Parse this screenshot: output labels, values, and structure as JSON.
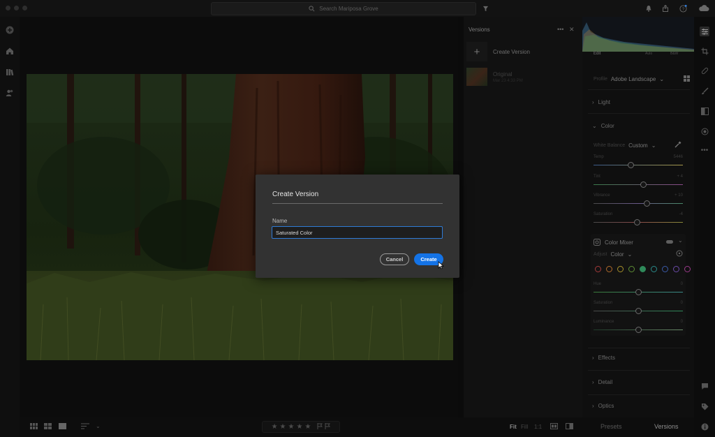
{
  "search": {
    "placeholder": "Search Mariposa Grove"
  },
  "versions_panel": {
    "title": "Versions",
    "more_label": "•••",
    "close_label": "✕",
    "create_label": "Create Version",
    "original_name": "Original",
    "original_date": "Mar 23 4:33 PM"
  },
  "histogram": {
    "edit_label": "Edit",
    "auto_label": "Auto",
    "bw_label": "B&W"
  },
  "profile": {
    "label": "Profile",
    "value": "Adobe Landscape"
  },
  "sections": {
    "light": "Light",
    "color": "Color",
    "effects": "Effects",
    "detail": "Detail",
    "optics": "Optics"
  },
  "color_panel": {
    "white_balance_label": "White Balance",
    "white_balance_value": "Custom",
    "temp": {
      "label": "Temp",
      "value": "5446",
      "position": 0.42
    },
    "tint": {
      "label": "Tint",
      "value": "+ 4",
      "position": 0.56
    },
    "vibrance": {
      "label": "Vibrance",
      "value": "+ 10",
      "position": 0.6
    },
    "saturation": {
      "label": "Saturation",
      "value": "-4",
      "position": 0.49
    }
  },
  "color_mixer": {
    "title": "Color Mixer",
    "adjust_label": "Adjust",
    "adjust_value": "Color",
    "hue": {
      "label": "Hue",
      "value": "0",
      "position": 0.5
    },
    "saturation": {
      "label": "Saturation",
      "value": "0",
      "position": 0.5
    },
    "luminance": {
      "label": "Luminance",
      "value": "0",
      "position": 0.5
    },
    "swatch_colors": [
      "#a33a3a",
      "#b06a2a",
      "#a58f2a",
      "#5d8d34",
      "#2f8a5a",
      "#2a8a8a",
      "#3a5aa8",
      "#6a4aa8",
      "#9a3a8a"
    ],
    "selected_swatch": 4
  },
  "bottom": {
    "zoom_fit": "Fit",
    "zoom_fill": "Fill",
    "zoom_1to1": "1:1",
    "presets_tab": "Presets",
    "versions_tab": "Versions"
  },
  "dialog": {
    "title": "Create Version",
    "name_label": "Name",
    "name_value": "Saturated Color",
    "cancel_label": "Cancel",
    "create_label": "Create"
  }
}
